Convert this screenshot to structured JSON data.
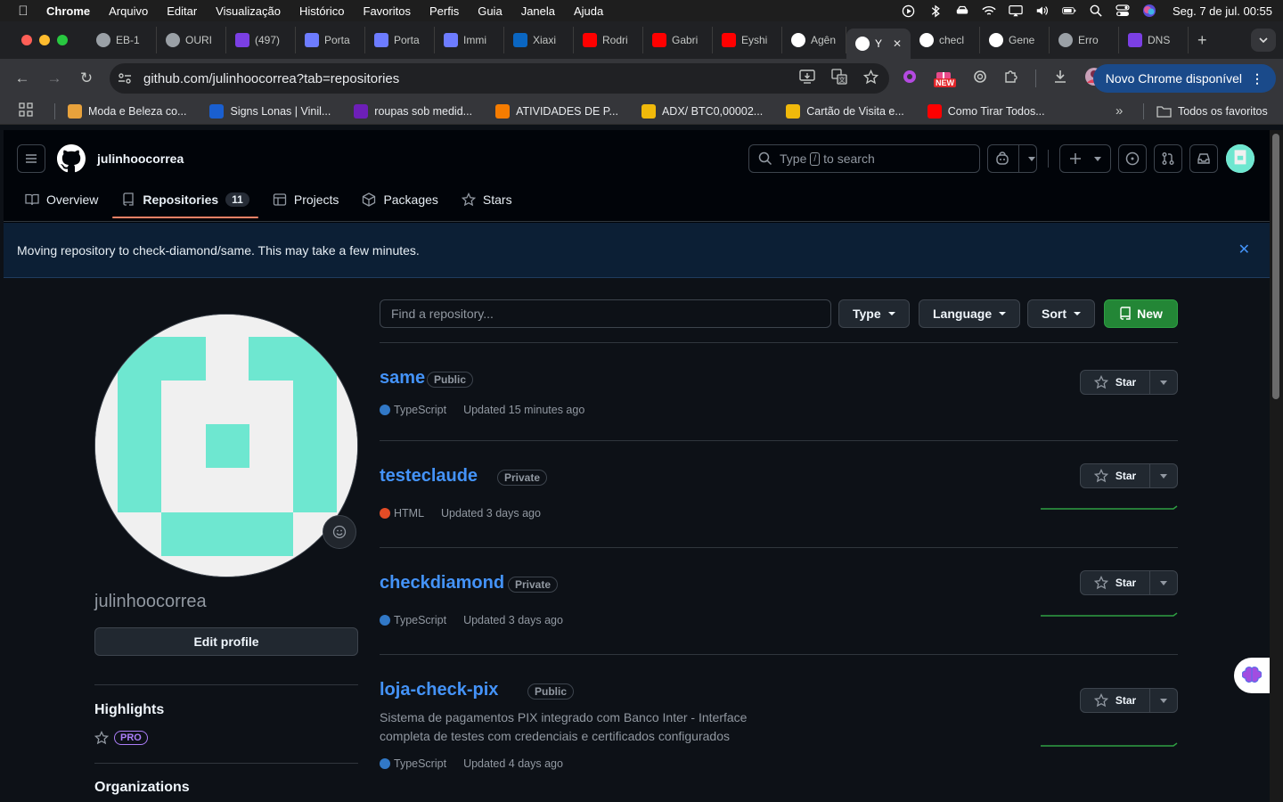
{
  "menubar": {
    "items": [
      "Chrome",
      "Arquivo",
      "Editar",
      "Visualização",
      "Histórico",
      "Favoritos",
      "Perfis",
      "Guia",
      "Janela",
      "Ajuda"
    ],
    "clock": "Seg. 7 de jul.  00:55"
  },
  "tabs": [
    {
      "label": "EB-1",
      "color": "#9aa0a6"
    },
    {
      "label": "OURI",
      "color": "#9aa0a6"
    },
    {
      "label": "(497)",
      "color": "#7b3fe4"
    },
    {
      "label": "Porta",
      "color": "#6d7cff"
    },
    {
      "label": "Porta",
      "color": "#6d7cff"
    },
    {
      "label": "Immi",
      "color": "#6d7cff"
    },
    {
      "label": "Xiaxi",
      "color": "#0a66c2"
    },
    {
      "label": "Rodri",
      "color": "#ff0000"
    },
    {
      "label": "Gabri",
      "color": "#ff0000"
    },
    {
      "label": "Eyshi",
      "color": "#ff0000"
    },
    {
      "label": "Agên",
      "color": "#ffffff"
    },
    {
      "label": "Y",
      "color": "#ffffff",
      "active": true
    },
    {
      "label": "checl",
      "color": "#ffffff"
    },
    {
      "label": "Gene",
      "color": "#ffffff"
    },
    {
      "label": "Erro",
      "color": "#9aa0a6"
    },
    {
      "label": "DNS",
      "color": "#7b3fe4"
    }
  ],
  "toolbar": {
    "url": "github.com/julinhoocorrea?tab=repositories",
    "update_label": "Novo Chrome disponível",
    "new_badge": "NEW"
  },
  "bookmarks": [
    {
      "label": "Moda e Beleza co...",
      "color": "#e8a23c"
    },
    {
      "label": "Signs Lonas | Vinil...",
      "color": "#1a5fd0"
    },
    {
      "label": "roupas sob medid...",
      "color": "#6d1fb8"
    },
    {
      "label": "ATIVIDADES DE P...",
      "color": "#f57c00"
    },
    {
      "label": "ADX/ BTC0,00002...",
      "color": "#f0b90b"
    },
    {
      "label": "Cartão de Visita e...",
      "color": "#f0b90b"
    },
    {
      "label": "Como Tirar Todos...",
      "color": "#ff0000"
    }
  ],
  "bookmarks_all": "Todos os favoritos",
  "github": {
    "username_header": "julinhoocorrea",
    "search_prefix": "Type",
    "search_key": "/",
    "search_suffix": "to search",
    "nav": [
      {
        "label": "Overview"
      },
      {
        "label": "Repositories",
        "count": "11",
        "selected": true
      },
      {
        "label": "Projects"
      },
      {
        "label": "Packages"
      },
      {
        "label": "Stars"
      }
    ],
    "flash": "Moving repository to check-diamond/same. This may take a few minutes.",
    "profile": {
      "username": "julinhoocorrea",
      "edit_label": "Edit profile",
      "highlights": "Highlights",
      "pro": "PRO",
      "organizations": "Organizations"
    },
    "filter": {
      "placeholder": "Find a repository...",
      "type": "Type",
      "language": "Language",
      "sort": "Sort",
      "new": "New"
    },
    "star_label": "Star",
    "repos": [
      {
        "name": "same",
        "visibility": "Public",
        "language": "TypeScript",
        "lang_color": "#3178c6",
        "updated": "Updated 15 minutes ago",
        "description": ""
      },
      {
        "name": "testeclaude",
        "visibility": "Private",
        "language": "HTML",
        "lang_color": "#e34c26",
        "updated": "Updated 3 days ago",
        "description": ""
      },
      {
        "name": "checkdiamond",
        "visibility": "Private",
        "language": "TypeScript",
        "lang_color": "#3178c6",
        "updated": "Updated 3 days ago",
        "description": ""
      },
      {
        "name": "loja-check-pix",
        "visibility": "Public",
        "language": "TypeScript",
        "lang_color": "#3178c6",
        "updated": "Updated 4 days ago",
        "description": "Sistema de pagamentos PIX integrado com Banco Inter - Interface completa de testes com credenciais e certificados configurados"
      }
    ]
  }
}
